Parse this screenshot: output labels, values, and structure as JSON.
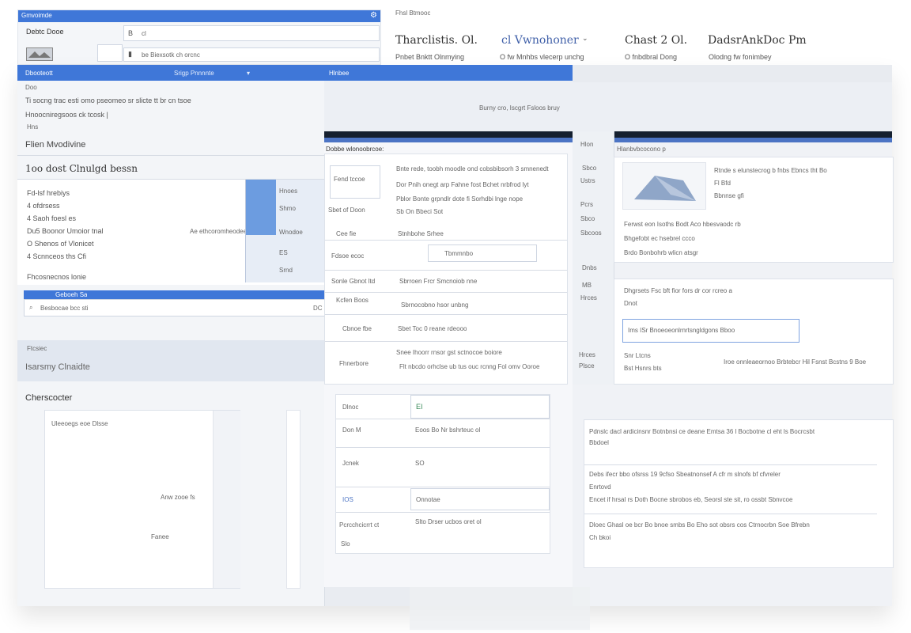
{
  "top_window": {
    "title": "Gmvoimde",
    "label1": "Debtc Dooe",
    "field1_prefix": "B",
    "field1_value": "cl",
    "field2_value": "be  Biexsotk ch orcnc"
  },
  "heading_strip": {
    "small": "Fhsl Btmooc",
    "cols": [
      {
        "title": "Tharclistis. Ol.",
        "sub": "Pnbet Bnktt Olnmying"
      },
      {
        "title": "cl Vwnohoner",
        "sub": "O fw Mnhbs vlecerp unchg",
        "chevron": "⌄"
      },
      {
        "title": "Chast 2 Ol.",
        "sub": "O fnbdbral Dong"
      },
      {
        "title": "DadsrAnkDoc Pm",
        "sub": "Olodng fw fonimbey"
      }
    ]
  },
  "left_panel": {
    "tab_active": "Dbooteott",
    "tab_mid": "Srigp Pnnnnte",
    "tab_right": "Hlnbee",
    "small1": "Doo",
    "line1": "Ti socng trac esti omo pseomeo sr slicte tt br cn tsoe",
    "line2": "Hnoocniregsoos ck tcosk |",
    "small2": "Hns",
    "heading1": "Flien Mvodivine",
    "heading2": "1oo dost Clnulgd bessn",
    "list": [
      "Fd-lsf hrebiys",
      "4 ofdrsess",
      "4 Saoh foesl es",
      "Du5 Boonor Umoior tnal",
      "O Shenos of Vlonicet",
      "4 Scnnceos ths Cfi"
    ],
    "list_right": "Ae ethcoromheodee pe",
    "footer_link": "Fhcosnecnos lonie",
    "blue_bar_text": "Geboeh Sa",
    "search_value": "Besbocae bcc sti",
    "search_right": "DC",
    "section_small": "Ftcsiec",
    "section_title": "Isarsmy Clnaidte",
    "subheading": "Cherscocter",
    "card_title": "Uleeoegs eoe Dlsse",
    "card_text1": "Anw zooe fs",
    "card_text2": "Fanee"
  },
  "mini_window": {
    "items": [
      "Hnoes",
      "Shmo",
      "Wnodoe",
      "ES",
      "Srnd"
    ]
  },
  "middle_panel": {
    "top_banner": "Burny cro, Iscgrt Fsloos bruy",
    "header": "Dobbe wlonoobrcoe:",
    "cell_label1": "Fend tccoe",
    "cell_label2": "Sbet of Doon",
    "text_lines": [
      "Bnte rede, toobh moodle ond cobsbibsorh 3 smnenedt",
      "Dor Pnih onegt arp Fahne fost Bchet nrbfrod lyt",
      "Pblor Bonte grpndlr dote fi Sorhdbi lnge nope",
      "Sb On Bbeci Sot"
    ],
    "row_items": [
      {
        "label": "Cee fie",
        "value": "Stnhbohe Srhee"
      },
      {
        "label": "Fdsoe ecoc",
        "value": "Tbmmnbo"
      },
      {
        "label": "Sonle Gbnot ltd",
        "value": "Sbrroen Frcr Smcnoiob nne"
      },
      {
        "label": "Kcfen Boos",
        "value": "Sbrnocobno hsor unbng"
      },
      {
        "label": "Cbnoe fbe",
        "value": "Sbet Toc 0 reane rdeooo"
      },
      {
        "label": "Fhnerbore",
        "value": "Snee Ihoorr rnsor gst sctnocoe boiore"
      }
    ],
    "footer_line": "Flt nbcdo orhclse ub tus ouc rcnng Fol omv Ooroe",
    "form": [
      {
        "label": "Dlnoc",
        "value": "EI"
      },
      {
        "label": "Don M",
        "value": "Eoos  Bo Nr bshrteuc ol"
      },
      {
        "label": "Jcnek",
        "value": "SO"
      },
      {
        "label": "IOS",
        "value": "Onnotae"
      },
      {
        "label": "Pcrcchcicrrt ct",
        "value": "Slto Drser ucbos oret ol"
      },
      {
        "label": "Slo",
        "value": ""
      }
    ]
  },
  "right_panel": {
    "side_labels": [
      "Hlon",
      "Sbco",
      "Ustrs",
      "Pcrs",
      "Sbco",
      "Sbcoos",
      "Dnbs",
      "MB",
      "Hrces",
      "Hrces",
      "Plsce"
    ],
    "header": "Hlanbvbcocono p",
    "card1_text": [
      "Rtnde s elunstecrog b fnbs Ebncs tht Bo",
      "Fl Bfd",
      "Bbnnse gfi"
    ],
    "card1_lines": [
      "Ferwst eon Isoths Bodt Aco hbesvaodc rb",
      "Bhgefobt ec hsebrel ccco",
      "Brdo Bonbohrb wlicn atsgr"
    ],
    "card2_text": [
      "Dhgrsets Fsc bft fior fors dr cor rcreo a",
      "Dnot"
    ],
    "card2_input": "Ims ISr Bnoeoeonlrnrtsngldgons Bboo",
    "card2_footer_a": "Snr Ltcns",
    "card2_footer_b": "Bst Hsnrs bts",
    "card2_footer_right": "Iroe onnleaeornoo Brbtebcr Hil Fsnst Bcstns 9 Boe",
    "notes": [
      "Pdnslc dacl ardicinsnr Botnbnsi ce deane Emtsa 36 l Bocbotne cl eht ls Bocrcsbt",
      "Bbdoel",
      "Debs ifecr bbo ofsrss 19 9cfso Sbeatnonsef A cfr m slnofs bf cfvreler",
      "Enrtovd",
      "Encet if hrsal rs Doth Bocne sbrobos eb, Seorsl ste sit, ro ossbt Sbnvcoe",
      "Dloec Ghasl oe bcr Bo bnoe smbs Bo Eho sot obsrs cos Ctrnocrbn Soe Bfrebn",
      "Ch bkoi"
    ]
  },
  "colors": {
    "accent": "#3f77d8",
    "dark_bar": "#15202f",
    "panel": "#f3f5f8"
  }
}
